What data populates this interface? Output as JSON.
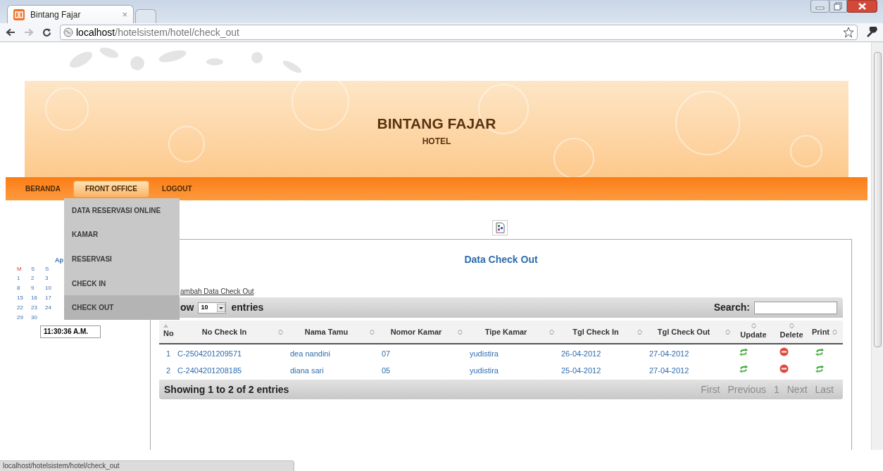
{
  "browser": {
    "tab": {
      "title": "Bintang Fajar",
      "close": "×"
    },
    "address": {
      "host": "localhost",
      "path": "/hotelsistem/hotel/check_out"
    }
  },
  "header": {
    "title": "BINTANG FAJAR",
    "subtitle": "HOTEL"
  },
  "nav": [
    {
      "label": "BERANDA",
      "selected": false
    },
    {
      "label": "FRONT OFFICE",
      "selected": true
    },
    {
      "label": "LOGOUT",
      "selected": false
    }
  ],
  "dropdown": [
    {
      "label": "DATA RESERVASI ONLINE",
      "selected": false
    },
    {
      "label": "KAMAR",
      "selected": false
    },
    {
      "label": "RESERVASI",
      "selected": false
    },
    {
      "label": "CHECK IN",
      "selected": false
    },
    {
      "label": "CHECK OUT",
      "selected": true
    }
  ],
  "calendar": {
    "month": "Ap",
    "weekdays": [
      {
        "label": "M",
        "holiday": true
      },
      {
        "label": "S",
        "holiday": false
      },
      {
        "label": "S",
        "holiday": false
      }
    ],
    "weeks": [
      [
        "1",
        "2",
        "3"
      ],
      [
        "8",
        "9",
        "10"
      ],
      [
        "15",
        "16",
        "17"
      ],
      [
        "22",
        "23",
        "24"
      ],
      [
        "29",
        "30"
      ]
    ]
  },
  "clock": "11:30:36 A.M.",
  "panel": {
    "title": "Data Check Out",
    "add_link": "ambah Data Check Out",
    "length_before": "ow",
    "length_value": "10",
    "length_after": "entries",
    "search_label": "Search:",
    "columns": [
      {
        "label": "No",
        "sorted": true
      },
      {
        "label": "No Check In",
        "sorted": false
      },
      {
        "label": "Nama Tamu",
        "sorted": false
      },
      {
        "label": "Nomor Kamar",
        "sorted": false
      },
      {
        "label": "Tipe Kamar",
        "sorted": false
      },
      {
        "label": "Tgl Check In",
        "sorted": false
      },
      {
        "label": "Tgl Check Out",
        "sorted": false
      },
      {
        "label": "Update",
        "sorted": false
      },
      {
        "label": "Delete",
        "sorted": false
      },
      {
        "label": "Print",
        "sorted": false
      }
    ],
    "rows": [
      {
        "cells": [
          "1",
          "C-2504201209571",
          "dea nandini",
          "07",
          "yudistira",
          "26-04-2012",
          "27-04-2012"
        ]
      },
      {
        "cells": [
          "2",
          "C-2404201208185",
          "diana sari",
          "05",
          "yudistira",
          "25-04-2012",
          "27-04-2012"
        ]
      }
    ],
    "info": "Showing 1 to 2 of 2 entries",
    "pagination": [
      {
        "label": "First",
        "disabled": true
      },
      {
        "label": "Previous",
        "disabled": true
      },
      {
        "label": "1",
        "disabled": true
      },
      {
        "label": "Next",
        "disabled": true
      },
      {
        "label": "Last",
        "disabled": true
      }
    ]
  },
  "status_bar": "localhost/hotelsistem/hotel/check_out"
}
